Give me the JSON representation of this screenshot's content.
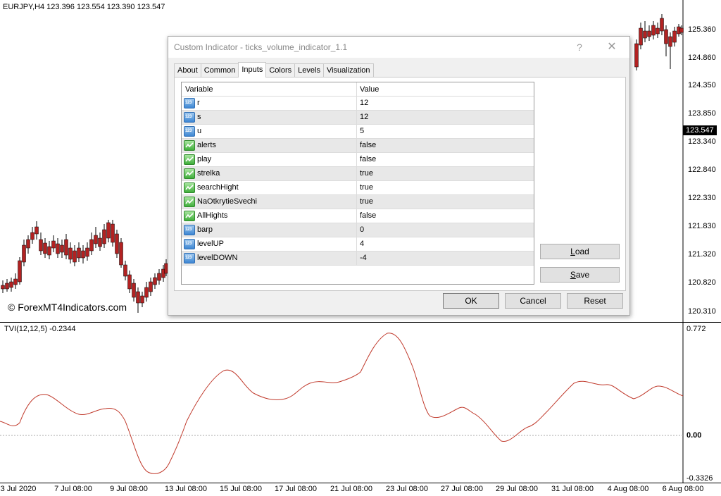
{
  "chart": {
    "symbol_info": "EURJPY,H4  123.396 123.554 123.390 123.547",
    "watermark": "© ForexMT4Indicators.com",
    "price_labels": [
      "125.360",
      "124.860",
      "124.350",
      "123.850",
      "123.340",
      "122.840",
      "122.330",
      "121.830",
      "121.320",
      "120.820",
      "120.310"
    ],
    "current_price": "123.547",
    "colors": {
      "bull": "#2ca02c",
      "bear": "#b22222",
      "indicator_line": "#c0392b"
    }
  },
  "indicator": {
    "label": "TVI(12,12,5) -0.2344",
    "scale_top": "0.772",
    "scale_zero": "0.00",
    "scale_bottom": "-0.3326"
  },
  "time_axis": [
    "3 Jul 2020",
    "7 Jul 08:00",
    "9 Jul 08:00",
    "13 Jul 08:00",
    "15 Jul 08:00",
    "17 Jul 08:00",
    "21 Jul 08:00",
    "23 Jul 08:00",
    "27 Jul 08:00",
    "29 Jul 08:00",
    "31 Jul 08:00",
    "4 Aug 08:00",
    "6 Aug 08:00"
  ],
  "dialog": {
    "title": "Custom Indicator - ticks_volume_indicator_1.1",
    "help_glyph": "?",
    "close_glyph": "✕",
    "tabs": [
      {
        "label": "About"
      },
      {
        "label": "Common"
      },
      {
        "label": "Inputs",
        "active": true
      },
      {
        "label": "Colors"
      },
      {
        "label": "Levels"
      },
      {
        "label": "Visualization"
      }
    ],
    "table": {
      "header_variable": "Variable",
      "header_value": "Value",
      "rows": [
        {
          "icon": "number-icon",
          "variable": "r",
          "value": "12"
        },
        {
          "icon": "number-icon",
          "variable": "s",
          "value": "12"
        },
        {
          "icon": "number-icon",
          "variable": "u",
          "value": "5"
        },
        {
          "icon": "boolean-icon",
          "variable": "alerts",
          "value": "false"
        },
        {
          "icon": "boolean-icon",
          "variable": "play",
          "value": "false"
        },
        {
          "icon": "boolean-icon",
          "variable": "strelka",
          "value": "true"
        },
        {
          "icon": "boolean-icon",
          "variable": "searchHight",
          "value": "true"
        },
        {
          "icon": "boolean-icon",
          "variable": "NaOtkrytieSvechi",
          "value": "true"
        },
        {
          "icon": "boolean-icon",
          "variable": "AllHights",
          "value": "false"
        },
        {
          "icon": "number-icon",
          "variable": "barp",
          "value": "0"
        },
        {
          "icon": "number-icon",
          "variable": "levelUP",
          "value": "4"
        },
        {
          "icon": "number-icon",
          "variable": "levelDOWN",
          "value": "-4"
        }
      ]
    },
    "number_icon_text": "123",
    "buttons": {
      "load": "Load",
      "save": "Save",
      "ok": "OK",
      "cancel": "Cancel",
      "reset": "Reset"
    }
  }
}
